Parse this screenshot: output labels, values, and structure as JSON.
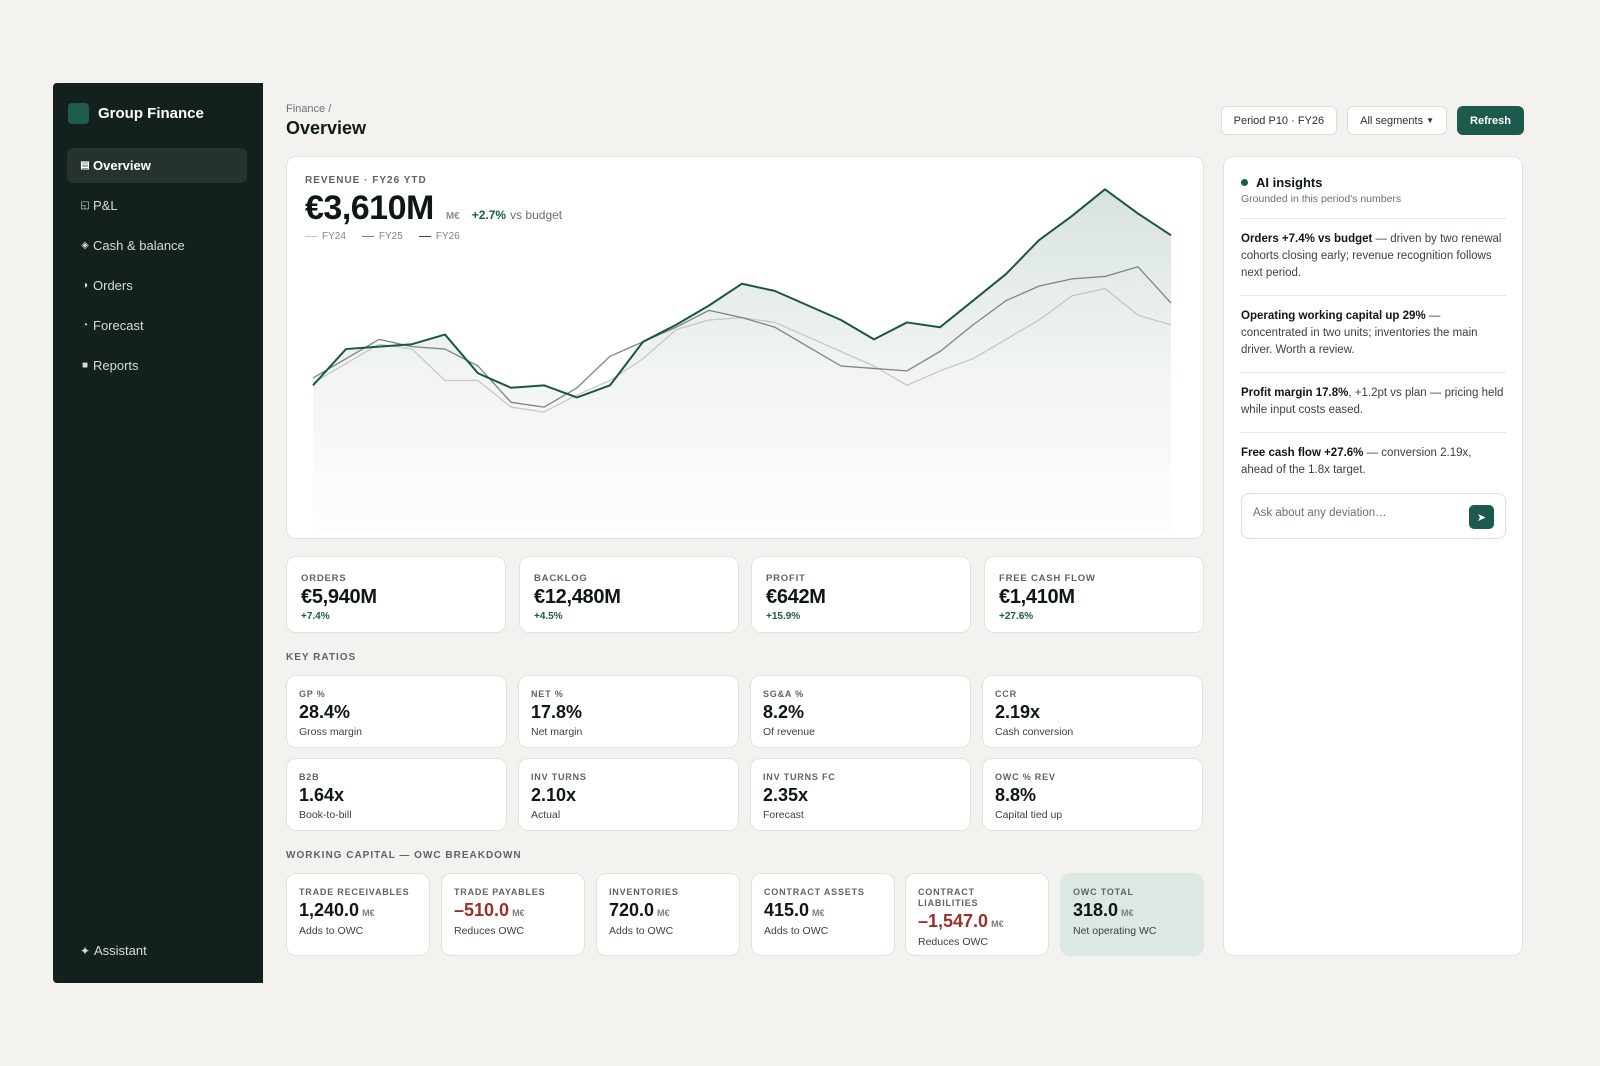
{
  "app": {
    "name": "Group Finance",
    "brand_color": "#1b5a4c"
  },
  "sidebar": {
    "items": [
      {
        "label": "Overview",
        "icon": "grid-icon",
        "glyph": "▤",
        "active": true
      },
      {
        "label": "P&L",
        "icon": "document-icon",
        "glyph": "◱"
      },
      {
        "label": "Cash & balance",
        "icon": "diamond-icon",
        "glyph": "◈"
      },
      {
        "label": "Orders",
        "icon": "half-circle-icon",
        "glyph": "◑"
      },
      {
        "label": "Forecast",
        "icon": "refresh-icon",
        "glyph": "◔"
      },
      {
        "label": "Reports",
        "icon": "square-icon",
        "glyph": "■"
      }
    ],
    "assistant": {
      "label": "Assistant",
      "glyph": "✦"
    }
  },
  "header": {
    "breadcrumb": "Finance /",
    "title": "Overview",
    "period": "Period P10 · FY26",
    "segments": "All segments",
    "refresh": "Refresh"
  },
  "revenue": {
    "label": "REVENUE · FY26 YTD",
    "value": "€3,610M",
    "unit": "M€",
    "delta": "+2.7%",
    "delta_suffix": "vs budget"
  },
  "chart_data": {
    "type": "line",
    "title": "",
    "xlabel": "",
    "ylabel": "",
    "x": [
      1,
      2,
      3,
      4,
      5,
      6,
      7,
      8,
      9,
      10,
      11,
      12,
      13,
      14,
      15,
      16,
      17,
      18,
      19,
      20,
      21,
      22,
      23,
      24,
      25,
      26,
      27
    ],
    "ylim": [
      0,
      100
    ],
    "grid": false,
    "legend": "top-left",
    "series": [
      {
        "name": "FY24",
        "color": "#c4c8c6",
        "values": [
          43,
          51,
          59,
          57,
          44,
          44,
          33,
          31,
          38,
          44,
          53,
          65,
          69,
          70,
          68,
          62,
          56,
          50,
          42,
          48,
          53,
          61,
          69,
          79,
          82,
          71,
          67
        ]
      },
      {
        "name": "FY25",
        "color": "#7e8482",
        "values": [
          45,
          53,
          61,
          58,
          57,
          50,
          35,
          33,
          41,
          54,
          60,
          66,
          73,
          70,
          66,
          58,
          50,
          49,
          48,
          56,
          67,
          77,
          83,
          86,
          87,
          91,
          76
        ]
      },
      {
        "name": "FY26",
        "color": "#1d5447",
        "values": [
          42,
          57,
          58,
          59,
          63,
          47,
          41,
          42,
          37,
          42,
          60,
          67,
          75,
          84,
          81,
          75,
          69,
          61,
          68,
          66,
          77,
          88,
          102,
          112,
          123,
          113,
          104
        ]
      }
    ]
  },
  "kpis": [
    {
      "label": "ORDERS",
      "value": "€5,940M",
      "delta": "+7.4%"
    },
    {
      "label": "BACKLOG",
      "value": "€12,480M",
      "delta": "+4.5%"
    },
    {
      "label": "PROFIT",
      "value": "€642M",
      "delta": "+15.9%"
    },
    {
      "label": "FREE CASH FLOW",
      "value": "€1,410M",
      "delta": "+27.6%"
    }
  ],
  "ratios": {
    "title": "KEY RATIOS",
    "items": [
      {
        "label": "GP %",
        "value": "28.4%",
        "sub": "Gross margin"
      },
      {
        "label": "NET %",
        "value": "17.8%",
        "sub": "Net margin"
      },
      {
        "label": "SG&A %",
        "value": "8.2%",
        "sub": "Of revenue"
      },
      {
        "label": "CCR",
        "value": "2.19x",
        "sub": "Cash conversion"
      },
      {
        "label": "B2B",
        "value": "1.64x",
        "sub": "Book-to-bill"
      },
      {
        "label": "INV TURNS",
        "value": "2.10x",
        "sub": "Actual"
      },
      {
        "label": "INV TURNS FC",
        "value": "2.35x",
        "sub": "Forecast"
      },
      {
        "label": "OWC % REV",
        "value": "8.8%",
        "sub": "Capital tied up"
      }
    ]
  },
  "working_capital": {
    "title": "WORKING CAPITAL — OWC BREAKDOWN",
    "unit": "M€",
    "items": [
      {
        "label": "TRADE RECEIVABLES",
        "value": "1,240.0",
        "sub": "Adds to OWC"
      },
      {
        "label": "TRADE PAYABLES",
        "value": "–510.0",
        "sub": "Reduces OWC"
      },
      {
        "label": "INVENTORIES",
        "value": "720.0",
        "sub": "Adds to OWC"
      },
      {
        "label": "CONTRACT ASSETS",
        "value": "415.0",
        "sub": "Adds to OWC"
      },
      {
        "label": "CONTRACT LIABILITIES",
        "value": "–1,547.0",
        "sub": "Reduces OWC"
      },
      {
        "label": "OWC TOTAL",
        "value": "318.0",
        "sub": "Net operating WC"
      }
    ]
  },
  "insights": {
    "title": "AI insights",
    "subtitle": "Grounded in this period's numbers",
    "items": [
      {
        "bold": "Orders +7.4% vs budget",
        "text": " — driven by two renewal cohorts closing early; revenue recognition follows next period."
      },
      {
        "bold": "Operating working capital up 29%",
        "text": " — concentrated in two units; inventories the main driver. Worth a review."
      },
      {
        "bold": "Profit margin 17.8%",
        "text": ", +1.2pt vs plan — pricing held while input costs eased."
      },
      {
        "bold": "Free cash flow +27.6%",
        "text": " — conversion 2.19x, ahead of the 1.8x target."
      }
    ],
    "ask_placeholder": "Ask about any deviation…",
    "send_glyph": "➤"
  }
}
